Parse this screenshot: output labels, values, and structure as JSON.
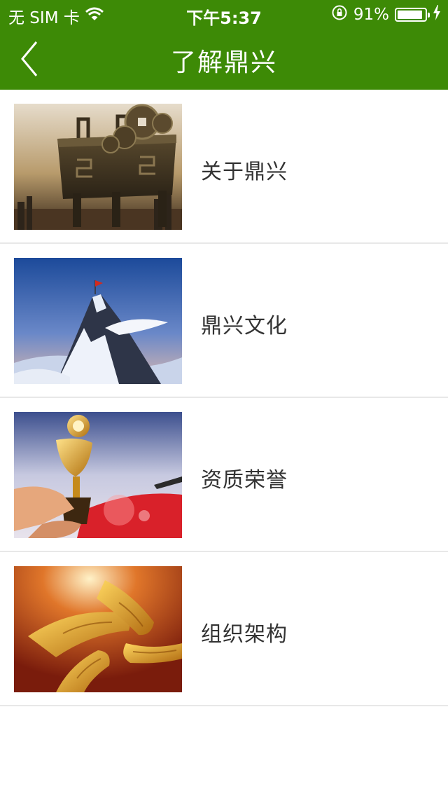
{
  "status_bar": {
    "carrier": "无 SIM 卡",
    "time": "下午5:37",
    "battery_percent": "91%",
    "battery_level": 0.91
  },
  "navbar": {
    "title": "了解鼎兴",
    "back_icon": "chevron-left-icon"
  },
  "items": [
    {
      "label": "关于鼎兴",
      "image": "bronze-ding-coins"
    },
    {
      "label": "鼎兴文化",
      "image": "mountain-peak-flag"
    },
    {
      "label": "资质荣誉",
      "image": "trophy-in-hands"
    },
    {
      "label": "组织架构",
      "image": "joined-golden-hands"
    }
  ],
  "colors": {
    "header_bg": "#3d8a06"
  }
}
